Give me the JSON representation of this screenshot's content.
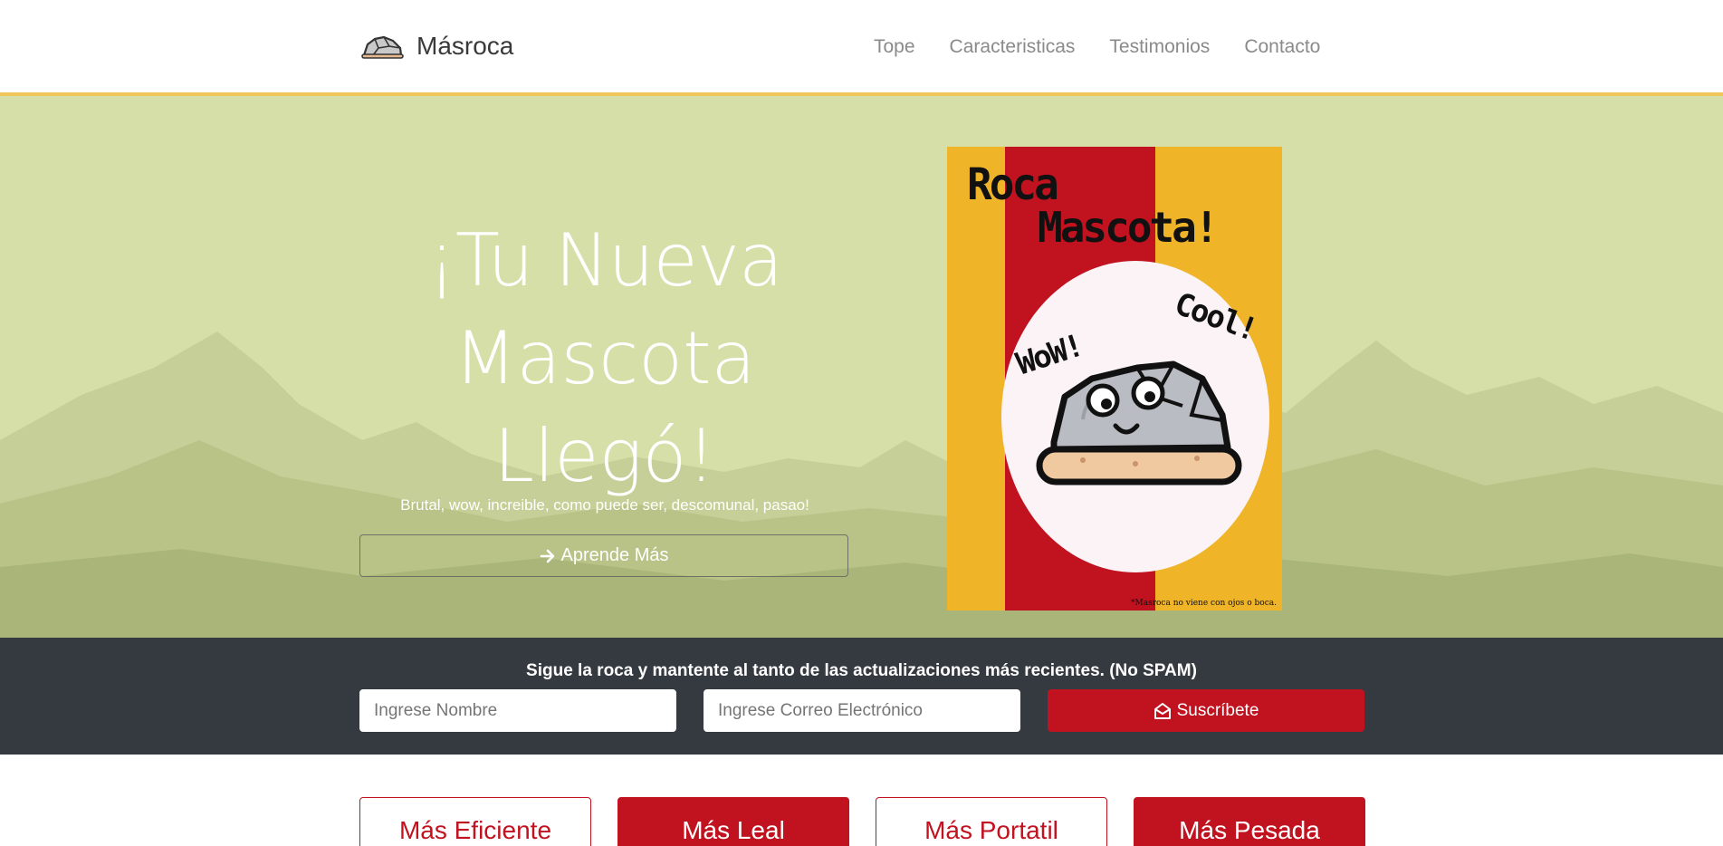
{
  "nav": {
    "brand": "Másroca",
    "logo_icon": "rock-icon",
    "links": [
      "Tope",
      "Caracteristicas",
      "Testimonios",
      "Contacto"
    ]
  },
  "hero": {
    "title_line1": "¡Tu Nueva",
    "title_line2": "Mascota",
    "title_line3": "Llegó!",
    "subtitle": "Brutal, wow, increible, como puede ser, descomunal, pasao!",
    "button_label": "Aprende Más",
    "button_icon": "arrow-right-icon",
    "background_color": "#d6dfa8"
  },
  "poster": {
    "title_line1": "Roca",
    "title_line2": "Mascota!",
    "bubble_left": "WoW!",
    "bubble_right": "Cool!",
    "footnote": "*Masroca no viene con ojos o boca."
  },
  "subscribe": {
    "text": "Sigue la roca y mantente al tanto de las actualizaciones más recientes. (No SPAM)",
    "name_placeholder": "Ingrese Nombre",
    "email_placeholder": "Ingrese Correo Electrónico",
    "button_label": "Suscríbete",
    "button_icon": "envelope-open-icon"
  },
  "features": {
    "cards": [
      "Más Eficiente",
      "Más Leal",
      "Más Portatil",
      "Más Pesada"
    ]
  },
  "colors": {
    "accent": "#c1121f",
    "poster_yellow": "#f0b429",
    "dark_band": "#343a40",
    "nav_border": "#f2c55a"
  }
}
